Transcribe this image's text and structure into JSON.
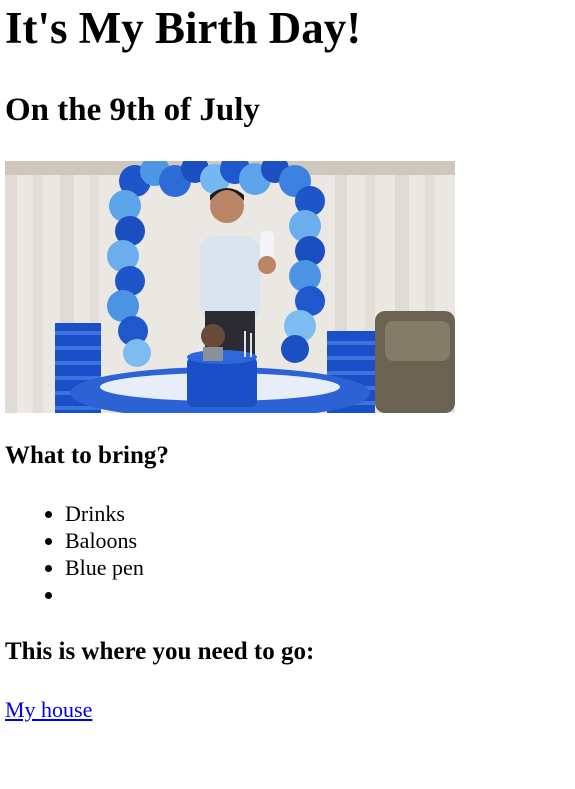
{
  "page": {
    "title": "It's My Birth Day!",
    "subtitle": "On the 9th of July"
  },
  "hero_image": {
    "accent_blue": "#1f5fd6",
    "light_blue": "#6fb2ee"
  },
  "bring": {
    "heading": "What to bring?",
    "items": [
      "Drinks",
      "Baloons",
      "Blue pen",
      ""
    ]
  },
  "location": {
    "heading": "This is where you need to go:",
    "link_text": "My house",
    "link_color": "#0000ee"
  }
}
